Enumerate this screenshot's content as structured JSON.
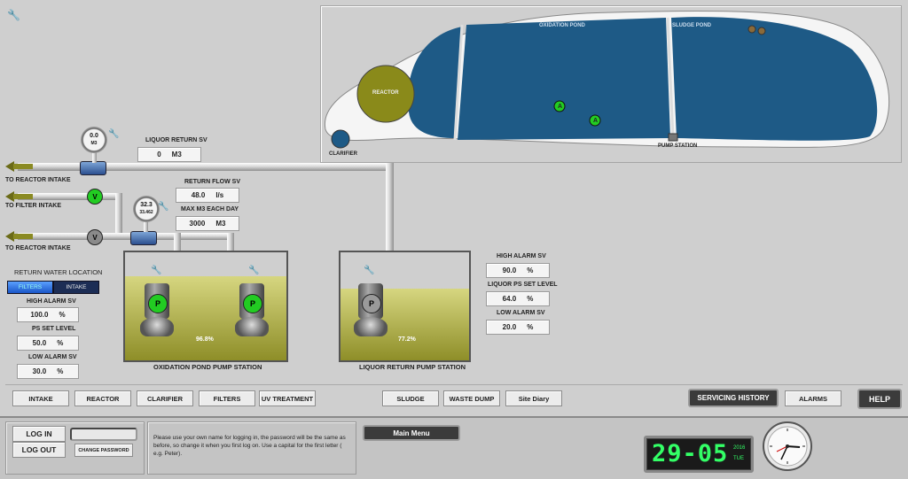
{
  "map": {
    "oxidation_pond": "OXIDATION POND",
    "sludge_pond": "SLUDGE POND",
    "reactor": "REACTOR",
    "clarifier": "CLARIFIER",
    "pump_station": "PUMP STATION",
    "aerator_label": "A"
  },
  "pipes": {
    "to_reactor_intake_1": "TO REACTOR INTAKE",
    "to_filter_intake": "TO FILTER INTAKE",
    "to_reactor_intake_2": "TO REACTOR INTAKE",
    "valve_open": "V",
    "valve_closed": "V"
  },
  "gauges": {
    "liquor": {
      "value": "0.0",
      "unit": "M3"
    },
    "return": {
      "value": "32.3",
      "unit": "33.462"
    }
  },
  "setpoints": {
    "liquor_return_sv": {
      "label": "LIQUOR RETURN SV",
      "value": "0",
      "unit": "M3"
    },
    "return_flow_sv": {
      "label": "RETURN FLOW SV",
      "value": "48.0",
      "unit": "l/s"
    },
    "max_m3_each_day": {
      "label": "MAX M3 EACH DAY",
      "value": "3000",
      "unit": "M3"
    },
    "return_water_location": "RETURN WATER LOCATION",
    "filters_btn": "FILTERS",
    "intake_btn": "INTAKE",
    "left_high_alarm": {
      "label": "HIGH ALARM SV",
      "value": "100.0",
      "unit": "%"
    },
    "left_ps_set": {
      "label": "PS SET LEVEL",
      "value": "50.0",
      "unit": "%"
    },
    "left_low_alarm": {
      "label": "LOW ALARM SV",
      "value": "30.0",
      "unit": "%"
    },
    "right_high_alarm": {
      "label": "HIGH ALARM SV",
      "value": "90.0",
      "unit": "%"
    },
    "right_ps_set": {
      "label": "LIQUOR PS SET LEVEL",
      "value": "64.0",
      "unit": "%"
    },
    "right_low_alarm": {
      "label": "LOW ALARM SV",
      "value": "20.0",
      "unit": "%"
    }
  },
  "stations": {
    "oxidation": {
      "title": "OXIDATION POND PUMP STATION",
      "level_text": "96.8%",
      "level": 0.78
    },
    "liquor": {
      "title": "LIQUOR RETURN PUMP STATION",
      "level_text": "77.2%",
      "level": 0.66
    },
    "pump_label": "P"
  },
  "nav": {
    "intake": "INTAKE",
    "reactor": "REACTOR",
    "clarifier": "CLARIFIER",
    "filters": "FILTERS",
    "uv": "UV TREATMENT",
    "sludge": "SLUDGE",
    "waste": "WASTE DUMP",
    "diary": "Site Diary",
    "servicing": "SERVICING HISTORY",
    "alarms": "ALARMS",
    "help": "HELP"
  },
  "footer": {
    "login": "LOG IN",
    "logout": "LOG OUT",
    "change_password": "CHANGE PASSWORD",
    "message": "Please use your own name for logging in, the password will be the same as before, so change it when you first log on. Use a capital for the first letter ( e.g. Peter).",
    "main_menu": "Main Menu",
    "clock_time": "29-05",
    "clock_year": "2016",
    "clock_day": "TUE"
  },
  "colors": {
    "pond": "#1e5a86",
    "liquid_light": "#d6d680",
    "liquid_dark": "#8e8e28",
    "valve_on": "#22cc22",
    "valve_off": "#8a8a8a",
    "lcd": "#33ff66"
  },
  "icons": [
    "wrench-icon",
    "aerator-icon",
    "analog-clock-icon",
    "arrow-left-icon"
  ]
}
